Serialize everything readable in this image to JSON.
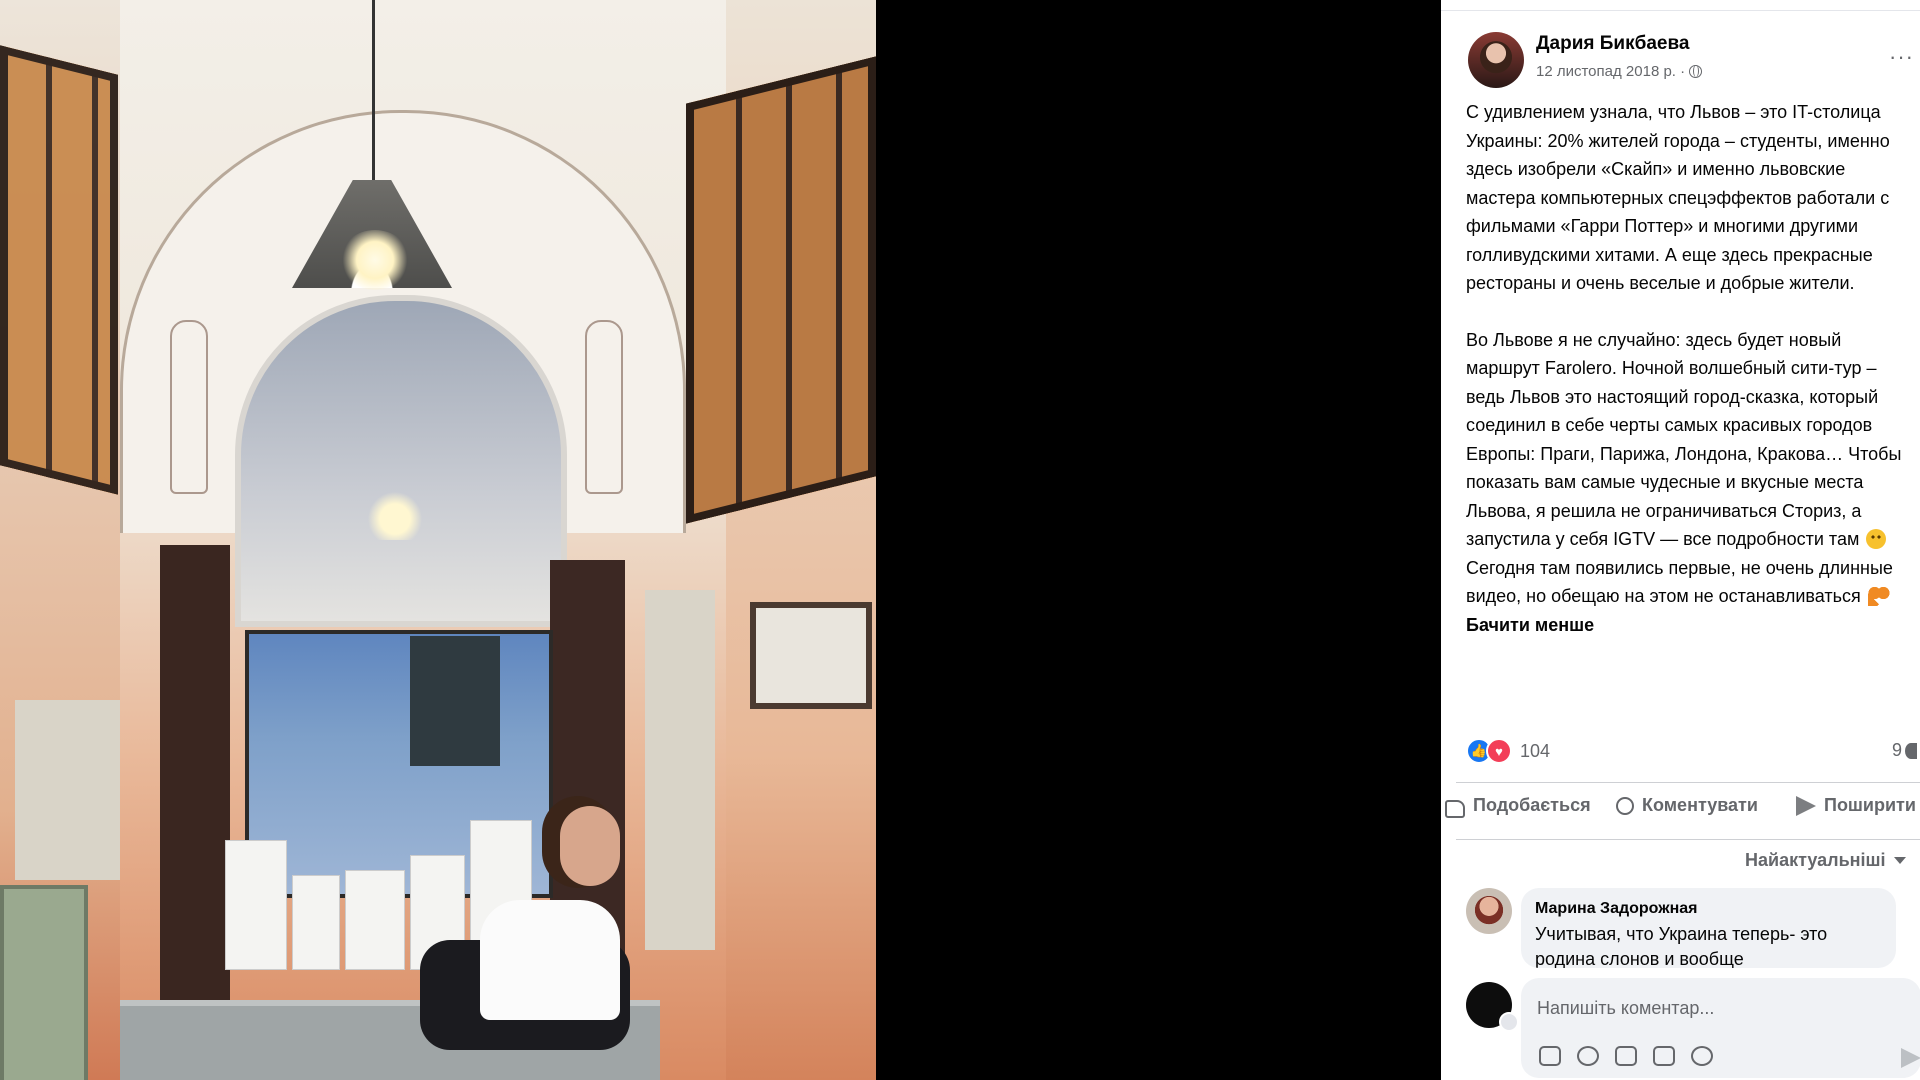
{
  "post": {
    "author": "Дария Бикбаева",
    "date": "12 листопад 2018 р. ·",
    "more_label": "···",
    "paragraph1": "С удивлением узнала, что Львов – это IT-столица Украины: 20% жителей города – студенты, именно здесь изобрели «Скайп» и именно львовские мастера компьютерных спецэффектов работали с фильмами «Гарри Поттер» и многими другими голливудскими хитами. А еще здесь прекрасные рестораны и очень веселые и добрые жители.",
    "paragraph2_a": "Во Львове я не случайно: здесь будет новый маршрут Farolero. Ночной волшебный сити-тур – ведь Львов это настоящий город-сказка, который соединил в себе черты самых красивых городов Европы: Праги, Парижа, Лондона, Кракова… Чтобы показать вам самые чудесные и вкусные места Львова, я решила не ограничиваться Сториз, а запустила у себя IGTV — все подробности там",
    "paragraph2_b": "Сегодня там появились первые, не очень длинные видео, но обещаю на этом не останавливаться",
    "see_less": "Бачити менше",
    "emoji_smile": "smile-emoji",
    "emoji_heart": "orange-heart-emoji"
  },
  "stats": {
    "reactions_count": "104",
    "comments_count": "9",
    "reaction_icons": [
      "like-icon",
      "love-icon"
    ]
  },
  "actions": {
    "like": "Подобається",
    "comment": "Коментувати",
    "share": "Поширити"
  },
  "sort": {
    "label": "Найактуальніші"
  },
  "comments": [
    {
      "name": "Марина Задорожная",
      "text": "Учитывая, что Украина теперь- это родина слонов и вообще"
    }
  ],
  "composer": {
    "placeholder": "Напишіть коментар...",
    "tools": [
      "sticker-icon",
      "emoji-icon",
      "camera-icon",
      "gif-icon",
      "sticker-face-icon"
    ]
  },
  "colors": {
    "accent": "#1877f2",
    "love": "#f33e58",
    "secondary_text": "#65676b",
    "bubble_bg": "#f0f2f5"
  }
}
